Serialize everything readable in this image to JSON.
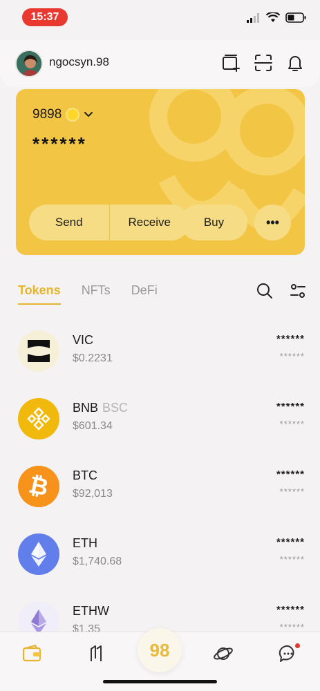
{
  "status_bar": {
    "time": "15:37"
  },
  "header": {
    "username": "ngocsyn.98"
  },
  "card": {
    "account_name": "9898",
    "balance": "******",
    "actions": {
      "send": "Send",
      "receive": "Receive",
      "buy": "Buy",
      "more": "•••"
    },
    "color": "#f2c544"
  },
  "tabs": [
    {
      "label": "Tokens",
      "active": true
    },
    {
      "label": "NFTs",
      "active": false
    },
    {
      "label": "DeFi",
      "active": false
    }
  ],
  "tokens": [
    {
      "symbol": "VIC",
      "network": "",
      "price": "$0.2231",
      "amount": "******",
      "value": "******",
      "icon": "vic-logo-icon"
    },
    {
      "symbol": "BNB",
      "network": "BSC",
      "price": "$601.34",
      "amount": "******",
      "value": "******",
      "icon": "bnb-logo-icon"
    },
    {
      "symbol": "BTC",
      "network": "",
      "price": "$92,013",
      "amount": "******",
      "value": "******",
      "icon": "btc-logo-icon"
    },
    {
      "symbol": "ETH",
      "network": "",
      "price": "$1,740.68",
      "amount": "******",
      "value": "******",
      "icon": "eth-logo-icon"
    },
    {
      "symbol": "ETHW",
      "network": "",
      "price": "$1.35",
      "amount": "******",
      "value": "******",
      "icon": "ethw-logo-icon"
    }
  ],
  "bottom_nav": {
    "center_label": "98"
  },
  "colors": {
    "accent": "#e7b430",
    "notification": "#e03a2e"
  }
}
